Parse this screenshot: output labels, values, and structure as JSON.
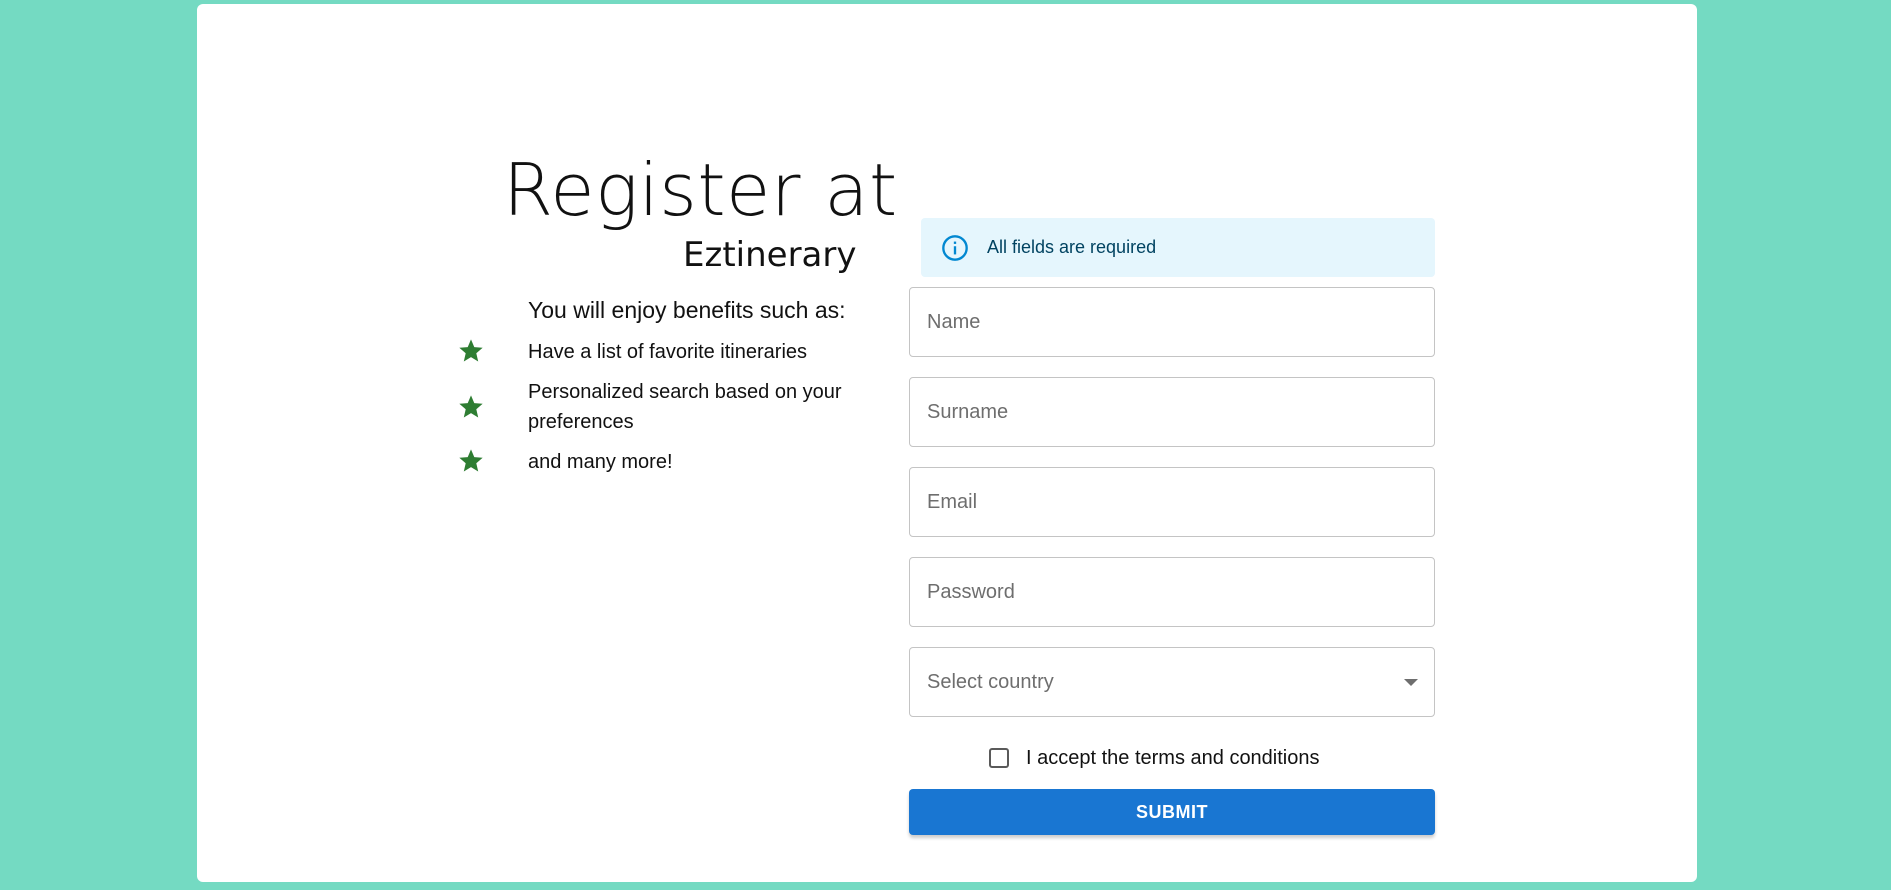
{
  "colors": {
    "background": "#74dac2",
    "card": "#ffffff",
    "star": "#2e7d32",
    "info": "#0288d1",
    "info_bg": "#e5f6fd",
    "primary": "#1976d2"
  },
  "intro": {
    "title": "Register at",
    "subtitle": "Eztinerary",
    "benefits_heading": "You will enjoy benefits such as:",
    "benefits": [
      {
        "icon": "star-icon",
        "text": "Have a list of favorite itineraries"
      },
      {
        "icon": "star-icon",
        "text": "Personalized search based on your preferences"
      },
      {
        "icon": "star-icon",
        "text": "and many more!"
      }
    ]
  },
  "form": {
    "alert": {
      "icon": "info-icon",
      "message": "All fields are required"
    },
    "fields": {
      "name": {
        "placeholder": "Name",
        "value": ""
      },
      "surname": {
        "placeholder": "Surname",
        "value": ""
      },
      "email": {
        "placeholder": "Email",
        "value": ""
      },
      "password": {
        "placeholder": "Password",
        "value": ""
      }
    },
    "country_select": {
      "placeholder": "Select country",
      "icon": "dropdown-caret-icon"
    },
    "terms": {
      "label": "I accept the terms and conditions",
      "checked": false
    },
    "submit_label": "SUBMIT"
  }
}
